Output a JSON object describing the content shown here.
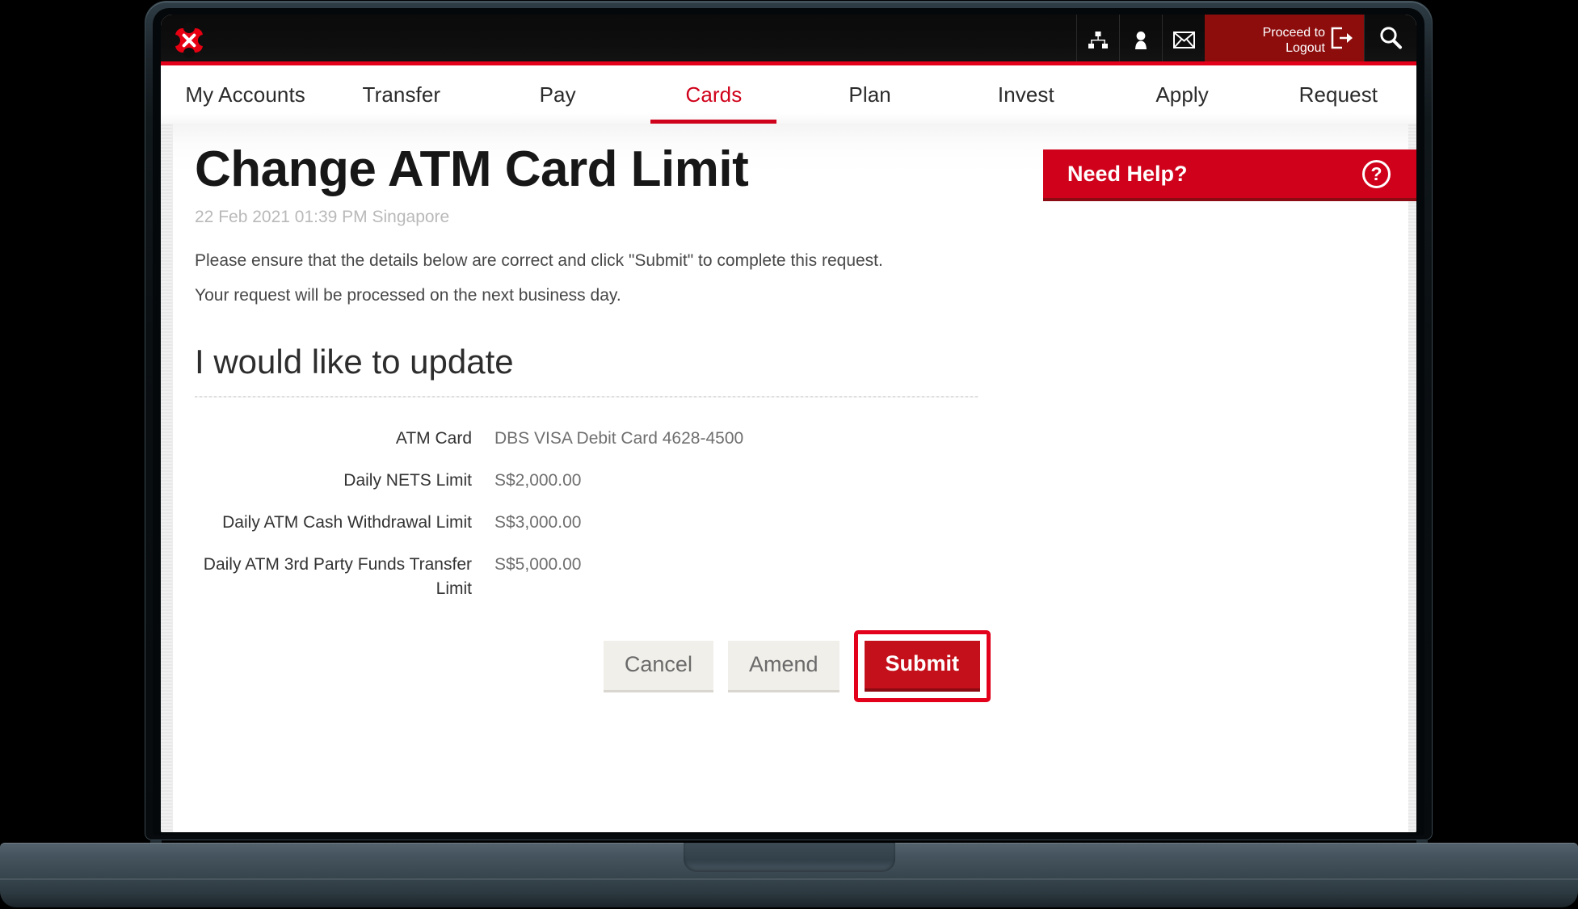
{
  "topbar": {
    "logo_name": "DBS logo",
    "icons": [
      {
        "name": "sitemap-icon",
        "label": "Sitemap"
      },
      {
        "name": "profile-icon",
        "label": "Profile"
      },
      {
        "name": "mail-icon",
        "label": "Messages"
      }
    ],
    "logout_label": "Proceed to\nLogout",
    "logout_icon": "logout-icon",
    "search_icon": "search-icon"
  },
  "nav": {
    "items": [
      {
        "label": "My Accounts",
        "active": false
      },
      {
        "label": "Transfer",
        "active": false
      },
      {
        "label": "Pay",
        "active": false
      },
      {
        "label": "Cards",
        "active": true
      },
      {
        "label": "Plan",
        "active": false
      },
      {
        "label": "Invest",
        "active": false
      },
      {
        "label": "Apply",
        "active": false
      },
      {
        "label": "Request",
        "active": false
      }
    ]
  },
  "page": {
    "title": "Change ATM Card Limit",
    "timestamp": "22 Feb 2021 01:39 PM Singapore",
    "intro_line_1": "Please ensure that the details below are correct and click \"Submit\" to complete this request.",
    "intro_line_2": "Your request will be processed on the next business day.",
    "section_heading": "I would like to update"
  },
  "details": {
    "rows": [
      {
        "label": "ATM Card",
        "value": "DBS VISA Debit Card 4628-4500"
      },
      {
        "label": "Daily NETS Limit",
        "value": "S$2,000.00"
      },
      {
        "label": "Daily ATM Cash Withdrawal Limit",
        "value": "S$3,000.00"
      },
      {
        "label": "Daily ATM 3rd Party Funds Transfer Limit",
        "value": "S$5,000.00"
      }
    ]
  },
  "buttons": {
    "cancel": "Cancel",
    "amend": "Amend",
    "submit": "Submit"
  },
  "need_help": {
    "label": "Need Help?",
    "icon": "question-mark-icon"
  },
  "colors": {
    "brand_red": "#d0021b",
    "accent_red": "#e2001a",
    "logout_red": "#8d0d0d",
    "submit_red": "#c4101a",
    "topbar_black": "#0e0e0e",
    "text_dark": "#2b2b2b",
    "text_muted": "#6f6f6f",
    "timestamp_grey": "#b9b9b9",
    "button_grey": "#f1efea",
    "laptop_base": "#3b4952"
  }
}
